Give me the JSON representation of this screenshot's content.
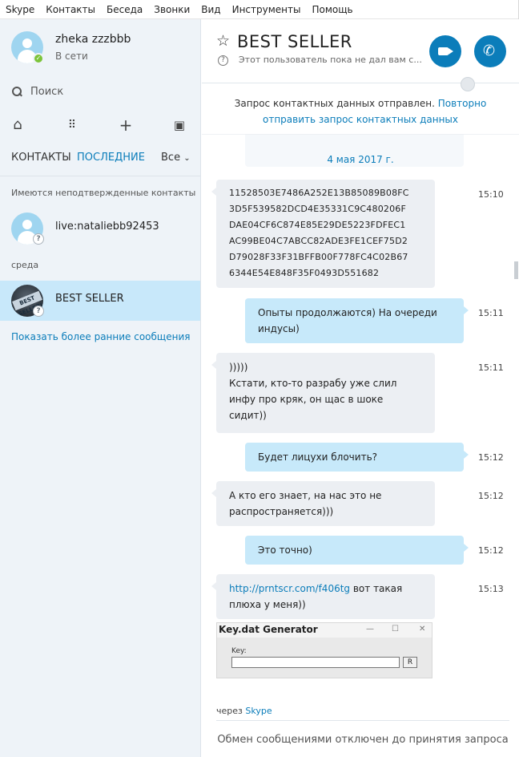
{
  "menu": [
    "Skype",
    "Контакты",
    "Беседа",
    "Звонки",
    "Вид",
    "Инструменты",
    "Помощь"
  ],
  "profile": {
    "name": "zheka zzzbbb",
    "status": "В сети"
  },
  "search": {
    "label": "Поиск"
  },
  "tabs": {
    "contacts": "КОНТАКТЫ",
    "recent": "ПОСЛЕДНИЕ",
    "filter": "Все"
  },
  "sidebar": {
    "unconfirmed_label": "Имеются неподтвержденные контакты",
    "contact1": "live:nataliebb92453",
    "day_label": "среда",
    "contact2": "BEST SELLER",
    "contact2_logo_text": "BEST SELLER!",
    "show_earlier": "Показать более ранние сообщения"
  },
  "chat": {
    "title": "BEST SELLER",
    "subtitle": "Этот пользователь пока не дал вам с...",
    "request_text": "Запрос контактных данных отправлен.",
    "request_link": "Повторно отправить запрос контактных данных",
    "date": "4 мая 2017 г.",
    "messages": [
      {
        "dir": "in",
        "time": "15:10",
        "lines": [
          "11528503E7486A252E13B85089B08FC",
          "3D5F539582DCD4E35331C9C480206F",
          "DAE04CF6C874E85E29DE5223FDFEC1",
          "AC99BE04C7ABCC82ADE3FE1CEF75D2",
          "D79028F33F31BFFB00F778FC4C02B67",
          "6344E54E848F35F0493D551682"
        ]
      },
      {
        "dir": "out",
        "time": "15:11",
        "text": "Опыты продолжаются) На очереди индусы)"
      },
      {
        "dir": "in",
        "time": "15:11",
        "line1": ")))))",
        "text": "Кстати, кто-то разрабу уже слил инфу про кряк, он щас в шоке сидит))"
      },
      {
        "dir": "out",
        "time": "15:12",
        "text": "Будет лицухи блочить?"
      },
      {
        "dir": "in",
        "time": "15:12",
        "text": "А кто его знает, на нас это не распространяется)))"
      },
      {
        "dir": "out",
        "time": "15:12",
        "text": "Это точно)"
      },
      {
        "dir": "in",
        "time": "15:13",
        "link": "http://prntscr.com/f406tg",
        "text": " вот такая плюха у меня))"
      }
    ],
    "image": {
      "title": "Key.dat Generator",
      "field_label": "Key:",
      "button": "R"
    },
    "via_text": "через",
    "via_link": "Skype",
    "footer": "Обмен сообщениями отключен до принятия запроса"
  }
}
